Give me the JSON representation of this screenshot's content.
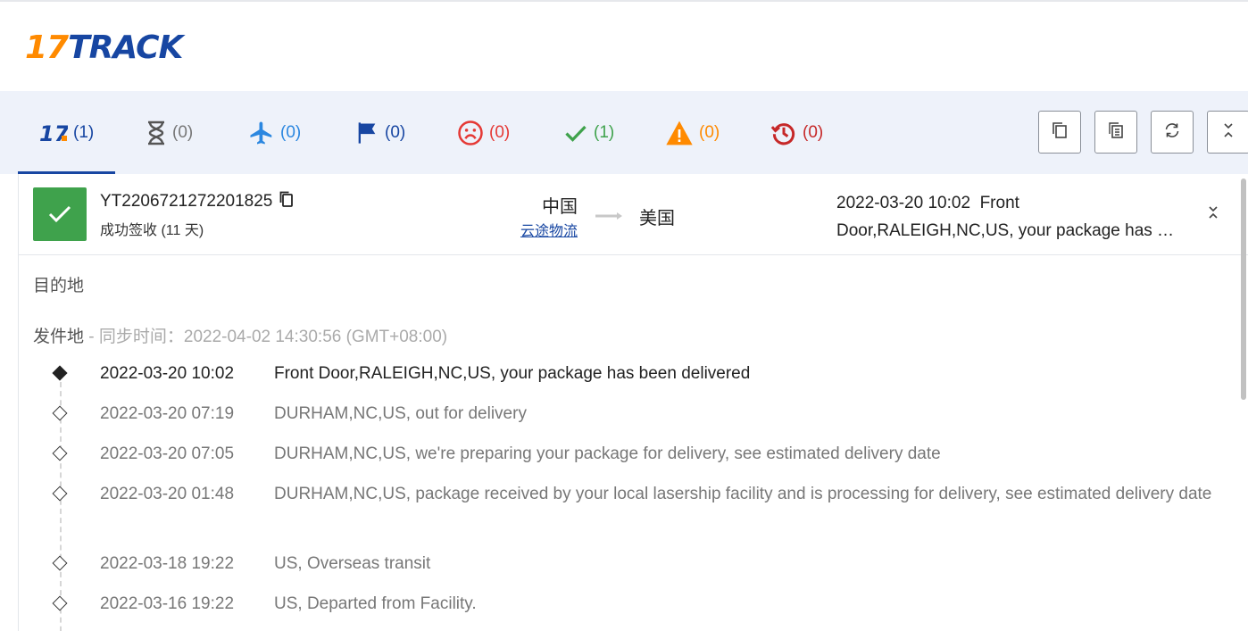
{
  "logo": {
    "seventeen": "17",
    "track": "TRACK"
  },
  "tabs": [
    {
      "count": "(1)",
      "icon": "17track-icon",
      "color": "#1746a2"
    },
    {
      "count": "(0)",
      "icon": "hourglass-icon",
      "color": "#777777"
    },
    {
      "count": "(0)",
      "icon": "airplane-icon",
      "color": "#2b87e0"
    },
    {
      "count": "(0)",
      "icon": "flag-icon",
      "color": "#1746a2"
    },
    {
      "count": "(0)",
      "icon": "sad-face-icon",
      "color": "#e53935"
    },
    {
      "count": "(1)",
      "icon": "checkmark-icon",
      "color": "#3fa24c"
    },
    {
      "count": "(0)",
      "icon": "warning-icon",
      "color": "#ff8a00"
    },
    {
      "count": "(0)",
      "icon": "history-icon",
      "color": "#c62828"
    }
  ],
  "toolbar": [
    "copy-icon",
    "copy-list-icon",
    "refresh-icon",
    "collapse-icon"
  ],
  "shipment": {
    "tracking_number": "YT2206721272201825",
    "status": "成功签收 (11 天)",
    "origin": "中国",
    "carrier": "云途物流",
    "destination": "美国",
    "latest_line1": "2022-03-20 10:02  Front",
    "latest_line2": "Door,RALEIGH,NC,US, your package has been delivered"
  },
  "sections": {
    "destination_label": "目的地",
    "origin_label": "发件地",
    "sync_label": " - 同步时间：2022-04-02 14:30:56 (GMT+08:00)"
  },
  "events": [
    {
      "time": "2022-03-20 10:02",
      "desc": "Front Door,RALEIGH,NC,US, your package has been delivered"
    },
    {
      "time": "2022-03-20 07:19",
      "desc": "DURHAM,NC,US, out for delivery"
    },
    {
      "time": "2022-03-20 07:05",
      "desc": "DURHAM,NC,US, we're preparing your package for delivery, see estimated delivery date"
    },
    {
      "time": "2022-03-20 01:48",
      "desc": "DURHAM,NC,US, package received by your local lasership facility and is processing for delivery, see estimated delivery date"
    },
    {
      "time": "2022-03-18 19:22",
      "desc": "US, Overseas transit"
    },
    {
      "time": "2022-03-16 19:22",
      "desc": "US, Departed from Facility."
    }
  ]
}
